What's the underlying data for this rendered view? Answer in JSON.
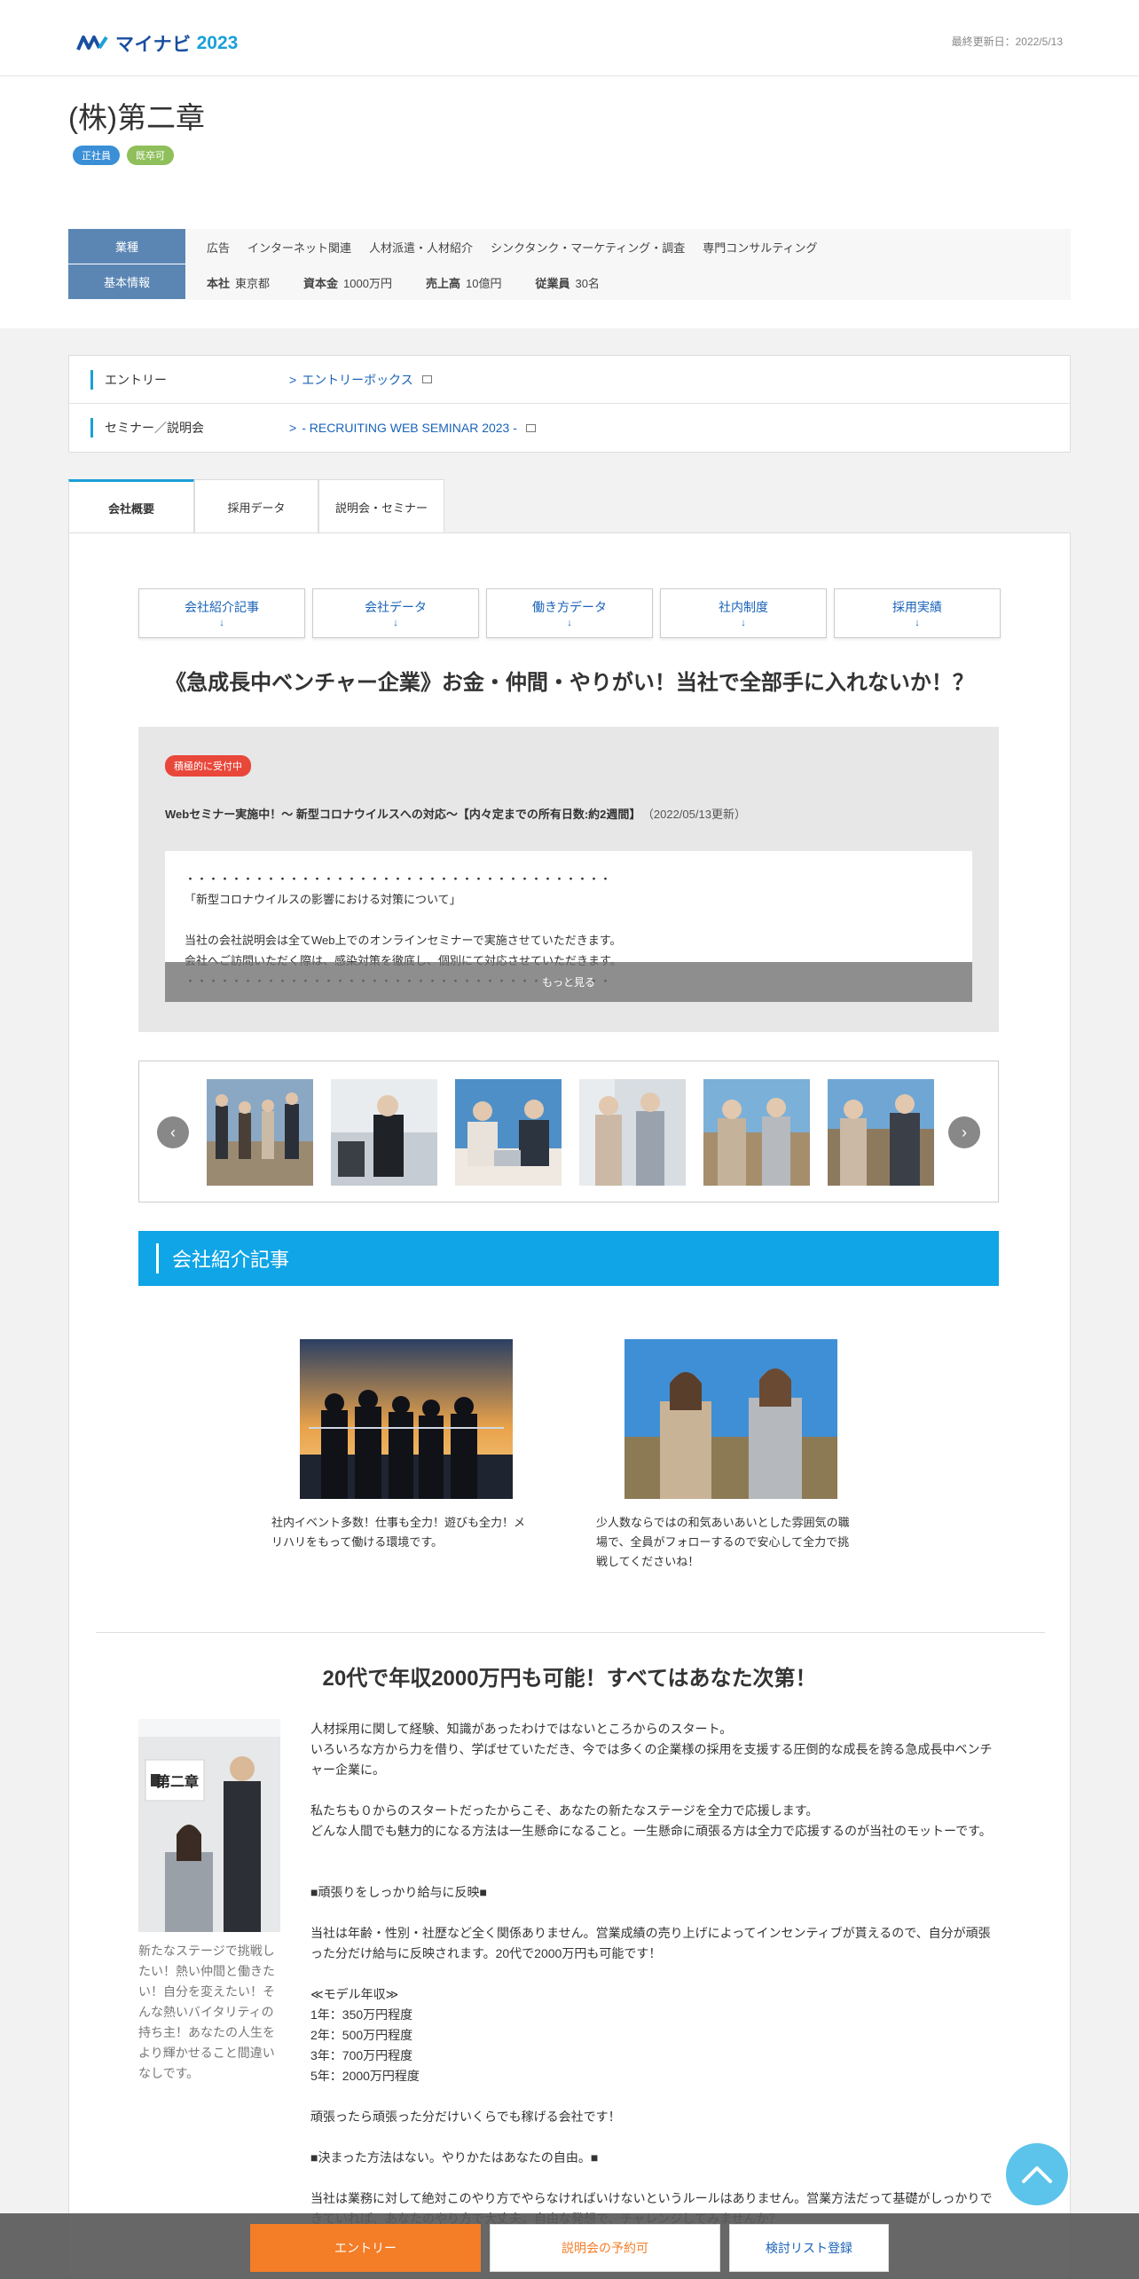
{
  "header": {
    "logo_text": "マイナビ",
    "logo_year": "2023",
    "updated": "最終更新日：2022/5/13"
  },
  "company": {
    "name": "(株)第二章",
    "badges": [
      "正社員",
      "既卒可"
    ],
    "industry_label": "業種",
    "industries": [
      "広告",
      "インターネット関連",
      "人材派遣・人材紹介",
      "シンクタンク・マーケティング・調査",
      "専門コンサルティング"
    ],
    "basic_label": "基本情報",
    "basic": [
      {
        "k": "本社",
        "v": "東京都"
      },
      {
        "k": "資本金",
        "v": "1000万円"
      },
      {
        "k": "売上高",
        "v": "10億円"
      },
      {
        "k": "従業員",
        "v": "30名"
      }
    ]
  },
  "entry": {
    "rows": [
      {
        "label": "エントリー",
        "link": "エントリーボックス"
      },
      {
        "label": "セミナー／説明会",
        "link": "- RECRUITING WEB SEMINAR 2023 -"
      }
    ]
  },
  "tabs": [
    "会社概要",
    "採用データ",
    "説明会・セミナー"
  ],
  "subnav": [
    "会社紹介記事",
    "会社データ",
    "働き方データ",
    "社内制度",
    "採用実績"
  ],
  "subnav_arrow": "↓",
  "catchcopy": "《急成長中ベンチャー企業》お金・仲間・やりがい！当社で全部手に入れないか！？",
  "news": {
    "badge": "積極的に受付中",
    "title": "Webセミナー実施中！～ 新型コロナウイルスへの対応～【内々定までの所有日数:約2週間】",
    "date": "（2022/05/13更新）",
    "lines": [
      "・・・・・・・・・・・・・・・・・・・・・・・・・・・・・・・・・・・・・",
      "「新型コロナウイルスの影響における対策について」",
      "",
      "当社の会社説明会は全てWeb上でのオンラインセミナーで実施させていただきます。",
      "会社へご訪問いただく際は、感染対策を徹底し、個別にて対応させていただきます。",
      "・・・・・・・・・・・・・・・・・・・・・・・・・・・・・・・・・・・・・"
    ],
    "more": "もっと見る"
  },
  "gallery": {
    "prev": "‹",
    "next": "›"
  },
  "section_title": "会社紹介記事",
  "articles": [
    {
      "text": "社内イベント多数！仕事も全力！遊びも全力！メリハリをもって働ける環境です。"
    },
    {
      "text": "少人数ならではの和気あいあいとした雰囲気の職場で、全員がフォローするので安心して全力で挑戦してくださいね！"
    }
  ],
  "pr": {
    "title": "20代で年収2000万円も可能！すべてはあなた次第！",
    "photo_sign": "第二章",
    "caption": "新たなステージで挑戦したい！熱い仲間と働きたい！自分を変えたい！そんな熱いバイタリティの持ち主！あなたの人生をより輝かせること間違いなしです。",
    "body": "人材採用に関して経験、知識があったわけではないところからのスタート。\nいろいろな方から力を借り、学ばせていただき、今では多くの企業様の採用を支援する圧倒的な成長を誇る急成長中ベンチャー企業に。\n\n私たちも０からのスタートだったからこそ、あなたの新たなステージを全力で応援します。\nどんな人間でも魅力的になる方法は一生懸命になること。一生懸命に頑張る方は全力で応援するのが当社のモットーです。\n\n\n■頑張りをしっかり給与に反映■\n\n当社は年齢・性別・社歴など全く関係ありません。営業成績の売り上げによってインセンティブが貰えるので、自分が頑張った分だけ給与に反映されます。20代で2000万円も可能です！\n\n≪モデル年収≫\n1年：350万円程度\n2年：500万円程度\n3年：700万円程度\n5年：2000万円程度\n\n頑張ったら頑張った分だけいくらでも稼げる会社です！\n\n■決まった方法はない。やりかたはあなたの自由。■\n\n当社は業務に対して絶対このやり方でやらなければいけないというルールはありません。営業方法だって基礎がしっかりできていれば、あなたのやり方で大丈夫。自由な発想で、チャレンジしてみませんか？"
  },
  "footer": {
    "entry": "エントリー",
    "reserve": "説明会の予約可",
    "list": "検討リスト登録"
  },
  "colors": {
    "accent": "#1aa0d8",
    "orange": "#f47d27",
    "navy": "#5b86b4"
  }
}
